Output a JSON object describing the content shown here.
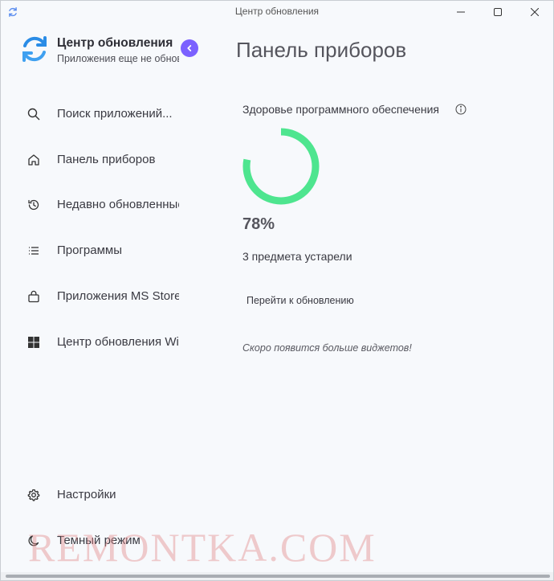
{
  "window": {
    "title": "Центр обновления",
    "icon": "refresh-icon"
  },
  "sidebar": {
    "app_name": "Центр обновления",
    "app_status": "Приложения еще не обновлены!",
    "items": [
      {
        "label": "Поиск приложений...",
        "icon": "search-icon"
      },
      {
        "label": "Панель приборов",
        "icon": "home-icon"
      },
      {
        "label": "Недавно обновленные",
        "icon": "history-icon"
      },
      {
        "label": "Программы",
        "icon": "list-icon"
      },
      {
        "label": "Приложения MS Store",
        "icon": "bag-icon"
      },
      {
        "label": "Центр обновления Windows",
        "icon": "windows-icon"
      },
      {
        "label": "Настройки",
        "icon": "gear-icon"
      },
      {
        "label": "Темный режим",
        "icon": "moon-icon"
      }
    ]
  },
  "main": {
    "title": "Панель приборов",
    "health_title": "Здоровье программного обеспечения",
    "health_percent_value": 78,
    "health_percent": "78%",
    "outdated_text": "3 предмета устарели",
    "goto_update_label": "Перейти к обновлению",
    "more_widgets": "Скоро появится больше виджетов!"
  },
  "colors": {
    "accent": "#7b61ff",
    "gauge": "#4ee58f",
    "logo_blue": "#2a8ce6"
  },
  "watermark": "REMONTKA.COM"
}
